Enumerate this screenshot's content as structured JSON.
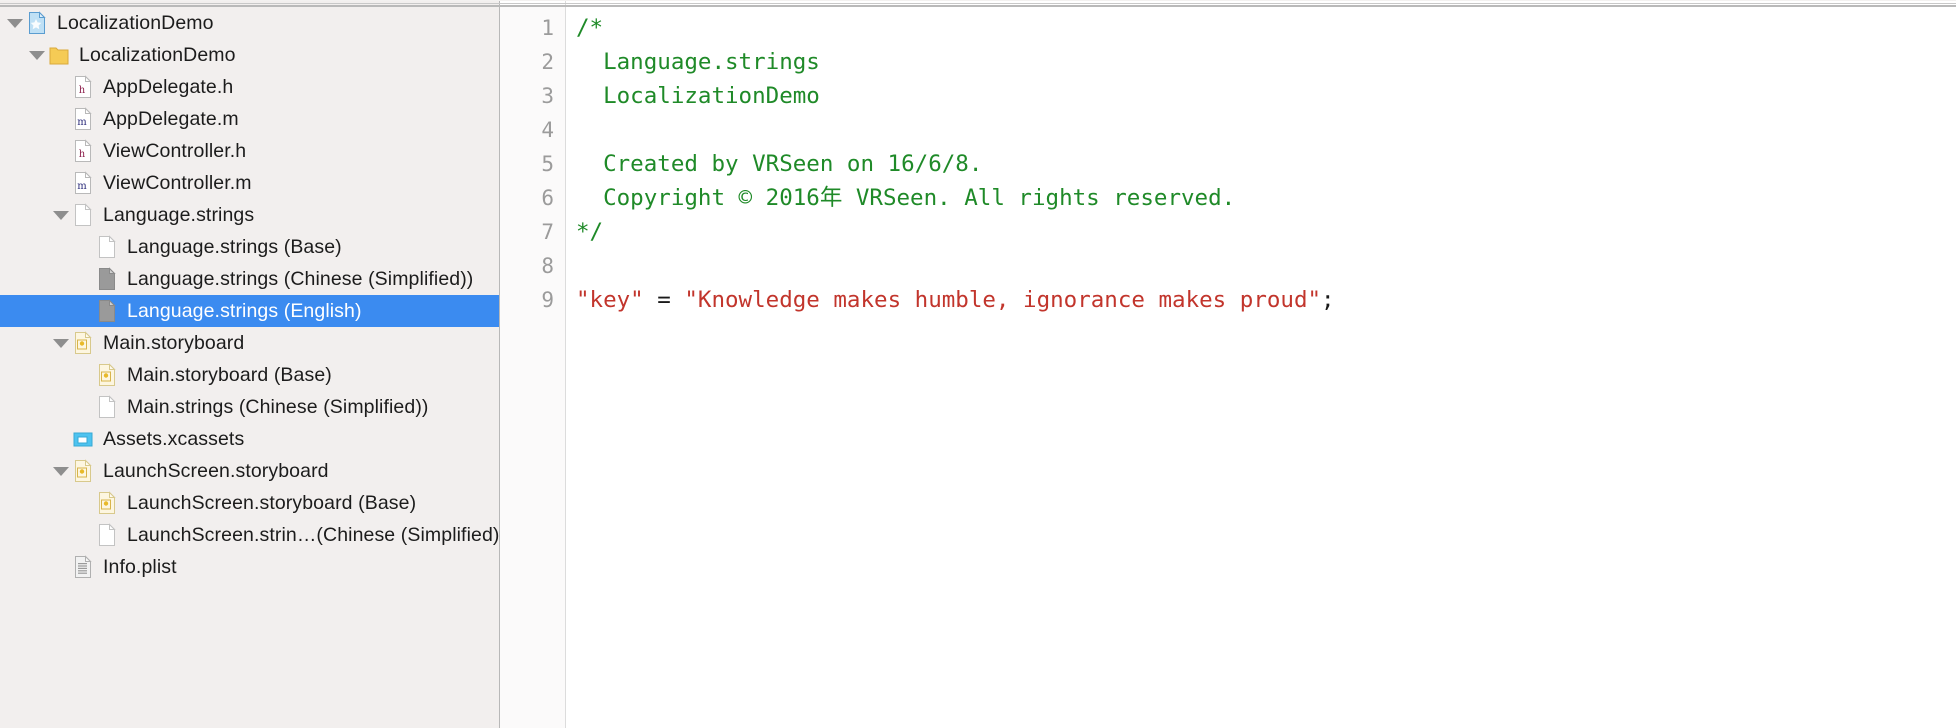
{
  "window": {
    "title": "LocalizationDemo"
  },
  "navigator": {
    "name": "project-navigator",
    "selected_index": 8,
    "selection_color": "#3b8bf0",
    "background_color": "#f2efee",
    "rows": [
      {
        "label": "LocalizationDemo",
        "icon": "xcode-project-icon",
        "indent": 0,
        "twisty": "open",
        "selected": false
      },
      {
        "label": "LocalizationDemo",
        "icon": "folder-icon",
        "indent": 1,
        "twisty": "open",
        "selected": false
      },
      {
        "label": "AppDelegate.h",
        "icon": "header-file-icon",
        "indent": 2,
        "twisty": "none",
        "selected": false
      },
      {
        "label": "AppDelegate.m",
        "icon": "objc-file-icon",
        "indent": 2,
        "twisty": "none",
        "selected": false
      },
      {
        "label": "ViewController.h",
        "icon": "header-file-icon",
        "indent": 2,
        "twisty": "none",
        "selected": false
      },
      {
        "label": "ViewController.m",
        "icon": "objc-file-icon",
        "indent": 2,
        "twisty": "none",
        "selected": false
      },
      {
        "label": "Language.strings",
        "icon": "strings-file-icon",
        "indent": 2,
        "twisty": "open",
        "selected": false
      },
      {
        "label": "Language.strings (Base)",
        "icon": "strings-file-icon",
        "indent": 3,
        "twisty": "none",
        "selected": false
      },
      {
        "label": "Language.strings (Chinese (Simplified))",
        "icon": "strings-file-gray-icon",
        "indent": 3,
        "twisty": "none",
        "selected": false
      },
      {
        "label": "Language.strings (English)",
        "icon": "strings-file-gray-icon",
        "indent": 3,
        "twisty": "none",
        "selected": true
      },
      {
        "label": "Main.storyboard",
        "icon": "storyboard-icon",
        "indent": 2,
        "twisty": "open",
        "selected": false
      },
      {
        "label": "Main.storyboard (Base)",
        "icon": "storyboard-icon",
        "indent": 3,
        "twisty": "none",
        "selected": false
      },
      {
        "label": "Main.strings (Chinese (Simplified))",
        "icon": "strings-file-icon",
        "indent": 3,
        "twisty": "none",
        "selected": false
      },
      {
        "label": "Assets.xcassets",
        "icon": "xcassets-icon",
        "indent": 2,
        "twisty": "none",
        "selected": false
      },
      {
        "label": "LaunchScreen.storyboard",
        "icon": "storyboard-icon",
        "indent": 2,
        "twisty": "open",
        "selected": false
      },
      {
        "label": "LaunchScreen.storyboard (Base)",
        "icon": "storyboard-icon",
        "indent": 3,
        "twisty": "none",
        "selected": false
      },
      {
        "label": "LaunchScreen.strin…(Chinese (Simplified))",
        "icon": "strings-file-icon",
        "indent": 3,
        "twisty": "none",
        "selected": false
      },
      {
        "label": "Info.plist",
        "icon": "plist-icon",
        "indent": 2,
        "twisty": "none",
        "selected": false
      }
    ]
  },
  "editor": {
    "name": "source-editor",
    "file": "Language.strings (English)",
    "comment_color": "#1f8a28",
    "string_color": "#c2352c",
    "plain_color": "#1a1a1a",
    "gutter_color": "#9b9b9b",
    "line_numbers": [
      "1",
      "2",
      "3",
      "4",
      "5",
      "6",
      "7",
      "8",
      "9"
    ],
    "lines": [
      {
        "number": "1",
        "tokens": [
          {
            "text": "/*",
            "type": "comment"
          }
        ]
      },
      {
        "number": "2",
        "tokens": [
          {
            "text": "  Language.strings",
            "type": "comment"
          }
        ]
      },
      {
        "number": "3",
        "tokens": [
          {
            "text": "  LocalizationDemo",
            "type": "comment"
          }
        ]
      },
      {
        "number": "4",
        "tokens": [
          {
            "text": "",
            "type": "comment"
          }
        ]
      },
      {
        "number": "5",
        "tokens": [
          {
            "text": "  Created by VRSeen on 16/6/8.",
            "type": "comment"
          }
        ]
      },
      {
        "number": "6",
        "tokens": [
          {
            "text": "  Copyright © 2016年 VRSeen. All rights reserved.",
            "type": "comment"
          }
        ]
      },
      {
        "number": "7",
        "tokens": [
          {
            "text": "*/",
            "type": "comment"
          }
        ]
      },
      {
        "number": "8",
        "tokens": [
          {
            "text": "",
            "type": "plain"
          }
        ]
      },
      {
        "number": "9",
        "tokens": [
          {
            "text": "\"key\"",
            "type": "string"
          },
          {
            "text": " = ",
            "type": "plain"
          },
          {
            "text": "\"Knowledge makes humble, ignorance makes proud\"",
            "type": "string"
          },
          {
            "text": ";",
            "type": "plain"
          }
        ]
      }
    ]
  }
}
